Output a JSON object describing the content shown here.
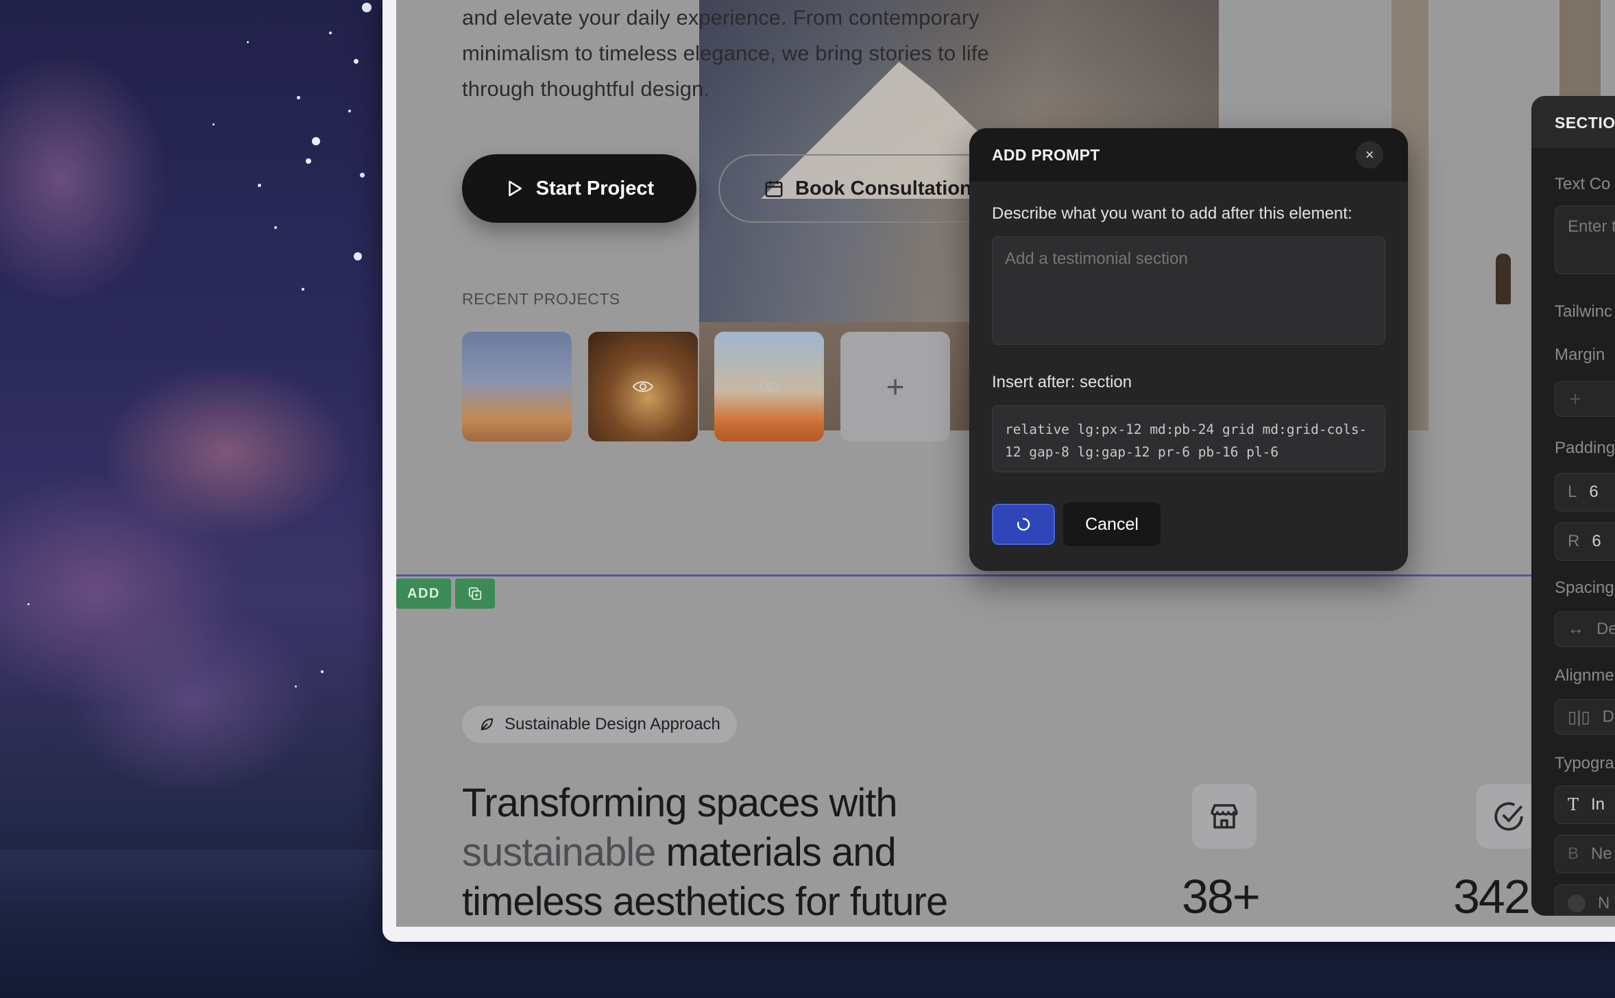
{
  "hero": {
    "line1": "and elevate your daily experience. From contemporary",
    "line2": "minimalism to timeless elegance, we bring stories to life",
    "line3": "through thoughtful design.",
    "start_button": "Start Project",
    "book_button": "Book Consultation"
  },
  "recent_projects": {
    "label": "RECENT PROJECTS",
    "add_symbol": "+"
  },
  "section_toolbar": {
    "add_label": "ADD"
  },
  "section": {
    "pill_label": "Sustainable Design Approach",
    "headline_part1": "Transforming spaces with",
    "headline_muted": "sustainable",
    "headline_part2": " materials and",
    "headline_part3": "timeless aesthetics for future",
    "stat1": "38+",
    "stat2": "342"
  },
  "panel": {
    "title": "SECTIO",
    "text_content_label": "Text Co",
    "text_placeholder": "Enter t",
    "tailwind_label": "Tailwinc",
    "margin_label": "Margin",
    "padding_label": "Padding",
    "padding_l": "L",
    "padding_l_value": "6",
    "padding_r": "R",
    "padding_r_value": "6",
    "spacing_label": "Spacing",
    "spacing_value": "De",
    "alignment_label": "Alignme",
    "alignment_value": "De",
    "typography_label": "Typogra",
    "font_value": "In",
    "weight_value": "Ne",
    "color_value": "N"
  },
  "modal": {
    "title": "ADD PROMPT",
    "describe_label": "Describe what you want to add after this element:",
    "textarea_placeholder": "Add a testimonial section",
    "insert_label": "Insert after: section",
    "class_line1": "relative lg:px-12 md:pb-24 grid md:grid-cols-",
    "class_line2": "12 gap-8 lg:gap-12 pr-6 pb-16 pl-6",
    "cancel_label": "Cancel",
    "close_symbol": "×"
  },
  "colors": {
    "accent_blue": "#2f46b8",
    "add_green": "#3c8a56",
    "modal_bg": "#252526"
  }
}
